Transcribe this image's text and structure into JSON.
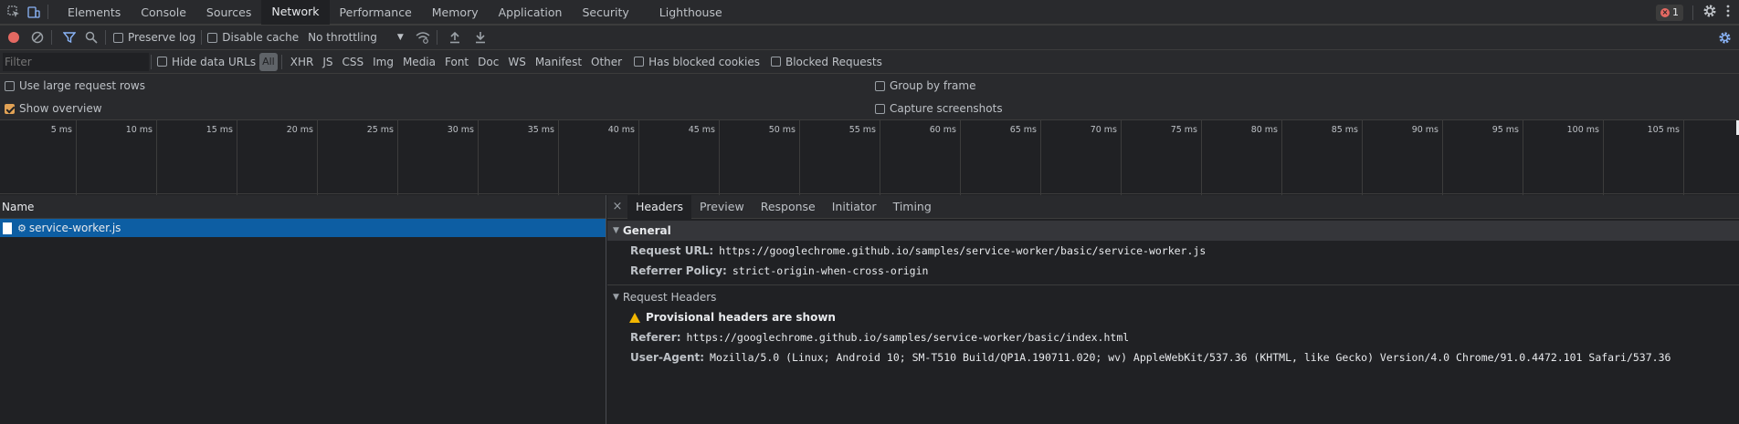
{
  "tabs": [
    "Elements",
    "Console",
    "Sources",
    "Network",
    "Performance",
    "Memory",
    "Application",
    "Security",
    "Lighthouse"
  ],
  "active_tab": "Network",
  "error_count": "1",
  "toolbar": {
    "preserve_log": "Preserve log",
    "disable_cache": "Disable cache",
    "throttling": "No throttling"
  },
  "filter": {
    "placeholder": "Filter",
    "hide_data_urls": "Hide data URLs",
    "types": [
      "All",
      "XHR",
      "JS",
      "CSS",
      "Img",
      "Media",
      "Font",
      "Doc",
      "WS",
      "Manifest",
      "Other"
    ],
    "has_blocked_cookies": "Has blocked cookies",
    "blocked_requests": "Blocked Requests"
  },
  "settings": {
    "large_rows": "Use large request rows",
    "show_overview": "Show overview",
    "group_by_frame": "Group by frame",
    "capture_screenshots": "Capture screenshots"
  },
  "timeline_ticks": [
    "5 ms",
    "10 ms",
    "15 ms",
    "20 ms",
    "25 ms",
    "30 ms",
    "35 ms",
    "40 ms",
    "45 ms",
    "50 ms",
    "55 ms",
    "60 ms",
    "65 ms",
    "70 ms",
    "75 ms",
    "80 ms",
    "85 ms",
    "90 ms",
    "95 ms",
    "100 ms",
    "105 ms"
  ],
  "name_column": "Name",
  "request": {
    "name": "service-worker.js"
  },
  "detail_tabs": [
    "Headers",
    "Preview",
    "Response",
    "Initiator",
    "Timing"
  ],
  "general": {
    "title": "General",
    "request_url_label": "Request URL:",
    "request_url": "https://googlechrome.github.io/samples/service-worker/basic/service-worker.js",
    "referrer_policy_label": "Referrer Policy:",
    "referrer_policy": "strict-origin-when-cross-origin"
  },
  "request_headers": {
    "title": "Request Headers",
    "warning": "Provisional headers are shown",
    "referer_label": "Referer:",
    "referer": "https://googlechrome.github.io/samples/service-worker/basic/index.html",
    "user_agent_label": "User-Agent:",
    "user_agent": "Mozilla/5.0 (Linux; Android 10; SM-T510 Build/QP1A.190711.020; wv) AppleWebKit/537.36 (KHTML, like Gecko) Version/4.0 Chrome/91.0.4472.101 Safari/537.36"
  }
}
